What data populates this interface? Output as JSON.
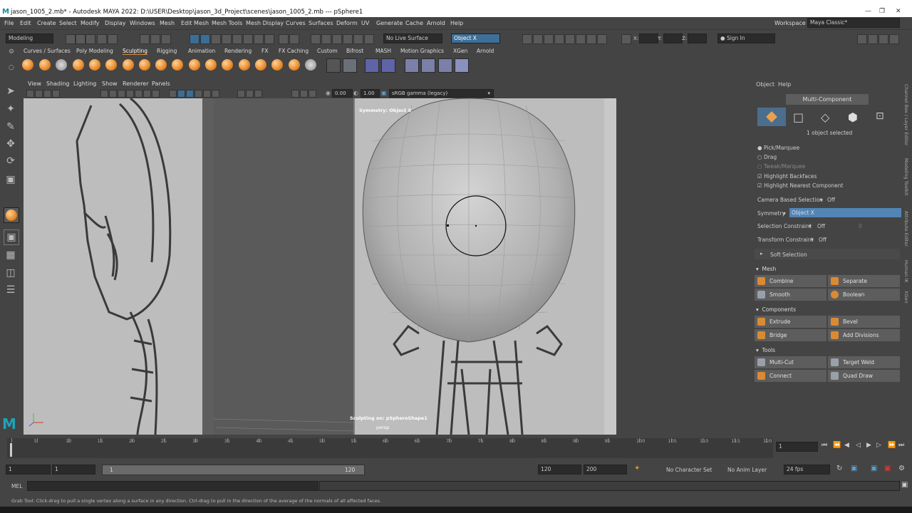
{
  "title_bar": {
    "logo": "M",
    "title": "jason_1005_2.mb* - Autodesk MAYA 2022: D:\\USER\\Desktop\\jason_3d_Project\\scenes\\jason_1005_2.mb   ---   pSphere1"
  },
  "menubar": {
    "items": [
      "File",
      "Edit",
      "Create",
      "Select",
      "Modify",
      "Display",
      "Windows",
      "Mesh",
      "Edit Mesh",
      "Mesh Tools",
      "Mesh Display",
      "Curves",
      "Surfaces",
      "Deform",
      "UV",
      "Generate",
      "Cache",
      "Arnold",
      "Help"
    ],
    "workspace_label": "Workspace :",
    "workspace_value": "Maya Classic*"
  },
  "statusline": {
    "mode": "Modeling",
    "live_surface": "No Live Surface",
    "symmetry": "Object X",
    "x_label": "X:",
    "y_label": "Y:",
    "z_label": "Z:",
    "sign_in": "Sign In"
  },
  "shelf": {
    "tabs": [
      "Curves / Surfaces",
      "Poly Modeling",
      "Sculpting",
      "Rigging",
      "Animation",
      "Rendering",
      "FX",
      "FX Caching",
      "Custom",
      "Bifrost",
      "MASH",
      "Motion Graphics",
      "XGen",
      "Arnold"
    ],
    "active_tab": "Sculpting"
  },
  "viewport": {
    "menu": [
      "View",
      "Shading",
      "Lighting",
      "Show",
      "Renderer",
      "Panels"
    ],
    "exposure": "0.00",
    "gamma": "1.00",
    "color_space": "sRGB gamma (legacy)",
    "symmetry_label": "Symmetry: Object X",
    "sculpting_on": "Sculpting on: pSphereShape1",
    "camera": "persp"
  },
  "channel_box": {
    "menu": [
      "Object",
      "Help"
    ],
    "mode_title": "Multi-Component",
    "selected_count": "1 object selected",
    "pick_marquee": "Pick/Marquee",
    "drag": "Drag",
    "tweak_marquee": "Tweak/Marquee",
    "highlight_backfaces": "Highlight Backfaces",
    "highlight_nearest": "Highlight Nearest Component",
    "camera_based": "Camera Based Selection",
    "camera_based_value": "Off",
    "symmetry": "Symmetry",
    "symmetry_value": "Object X",
    "selection_constraint": "Selection Constraint",
    "selection_constraint_value": "Off",
    "selection_constraint_num": "0",
    "transform_constraint": "Transform Constraint",
    "transform_constraint_value": "Off",
    "soft_selection": "Soft Selection",
    "mesh_section": "Mesh",
    "mesh_buttons": [
      "Combine",
      "Separate",
      "Smooth",
      "Boolean"
    ],
    "components_section": "Components",
    "components_buttons": [
      "Extrude",
      "Bevel",
      "Bridge",
      "Add Divisions"
    ],
    "tools_section": "Tools",
    "tools_buttons": [
      "Multi-Cut",
      "Target Weld",
      "Connect",
      "Quad Draw"
    ]
  },
  "side_tabs": [
    "Channel Box / Layer Editor",
    "Modeling Toolkit",
    "Attribute Editor",
    "Human IK",
    "XGen"
  ],
  "timeline": {
    "ticks": [
      "1",
      "5",
      "10",
      "15",
      "20",
      "25",
      "30",
      "35",
      "40",
      "45",
      "50",
      "55",
      "60",
      "65",
      "70",
      "75",
      "80",
      "85",
      "90",
      "95",
      "100",
      "105",
      "110",
      "115",
      "120"
    ],
    "current_frame": "1"
  },
  "range": {
    "start": "1",
    "playback_start": "1",
    "slider_start": "1",
    "slider_end": "120",
    "playback_end": "120",
    "end": "200",
    "character_set": "No Character Set",
    "anim_layer": "No Anim Layer",
    "fps": "24 fps"
  },
  "command_line": {
    "label": "MEL"
  },
  "help_line": {
    "text": "Grab Tool: Click-drag to pull a single vertex along a surface in any direction. Ctrl-drag to pull in the direction of the average of the normals of all affected faces."
  }
}
